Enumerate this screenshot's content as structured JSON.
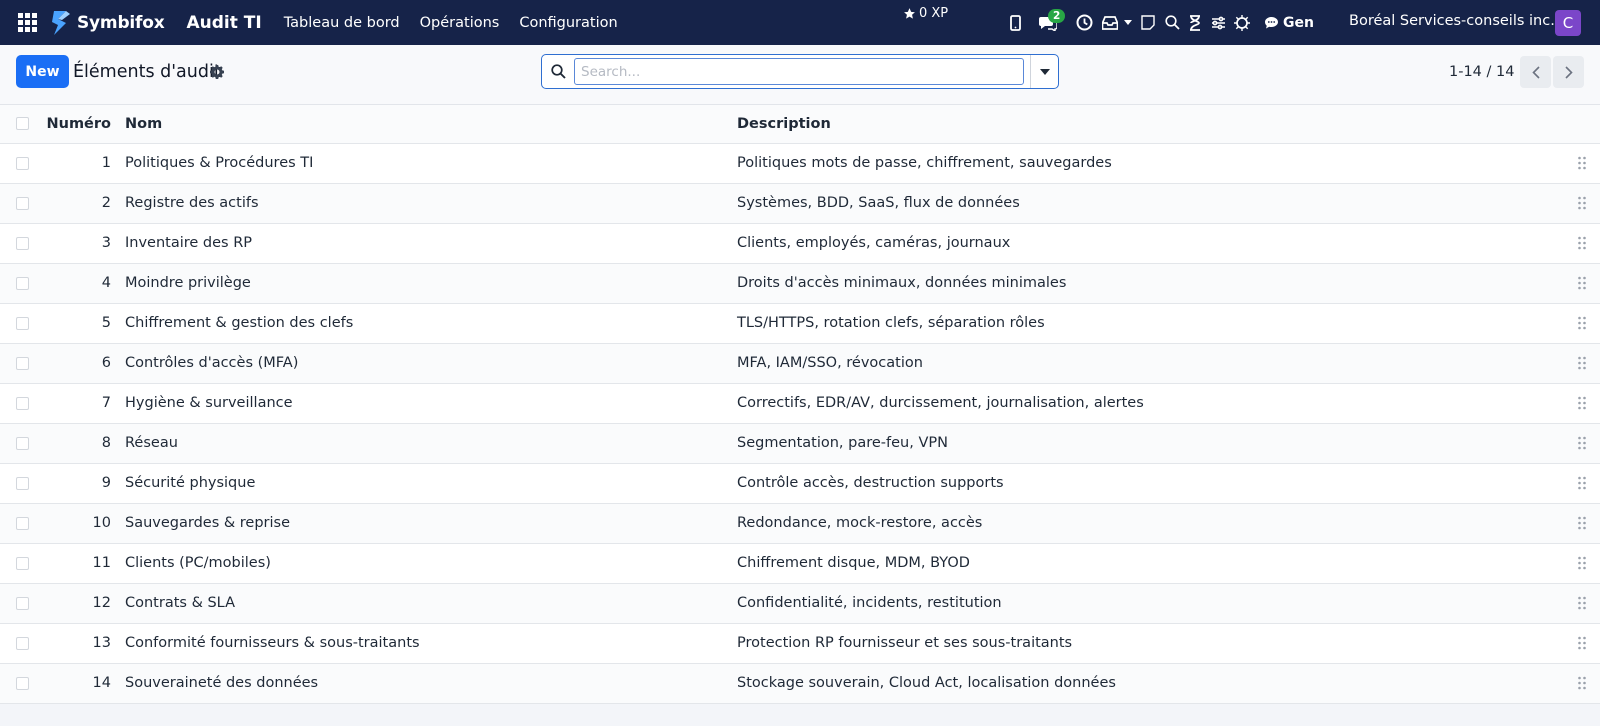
{
  "navbar": {
    "brand": "Symbifox",
    "app_title": "Audit TI",
    "menu": [
      "Tableau de bord",
      "Opérations",
      "Configuration"
    ],
    "xp": "0 XP",
    "messages_count": "2",
    "gen_label": "Gen",
    "company": "Boréal Services-conseils inc.",
    "avatar_letter": "C",
    "colors": {
      "bg": "#162349",
      "badge": "#28a745",
      "avatar": "#7b46c9"
    }
  },
  "control": {
    "new_label": "New",
    "title": "Éléments d'audit",
    "search_placeholder": "Search...",
    "pager": "1-14 / 14",
    "accent": "#1a6ef5"
  },
  "table": {
    "headers": {
      "number": "Numéro",
      "name": "Nom",
      "description": "Description"
    },
    "rows": [
      {
        "number": "1",
        "name": "Politiques & Procédures TI",
        "description": "Politiques mots de passe, chiffrement, sauvegardes"
      },
      {
        "number": "2",
        "name": "Registre des actifs",
        "description": "Systèmes, BDD, SaaS, flux de données"
      },
      {
        "number": "3",
        "name": "Inventaire des RP",
        "description": "Clients, employés, caméras, journaux"
      },
      {
        "number": "4",
        "name": "Moindre privilège",
        "description": "Droits d'accès minimaux, données minimales"
      },
      {
        "number": "5",
        "name": "Chiffrement & gestion des clefs",
        "description": "TLS/HTTPS, rotation clefs, séparation rôles"
      },
      {
        "number": "6",
        "name": "Contrôles d'accès (MFA)",
        "description": "MFA, IAM/SSO, révocation"
      },
      {
        "number": "7",
        "name": "Hygiène & surveillance",
        "description": "Correctifs, EDR/AV, durcissement, journalisation, alertes"
      },
      {
        "number": "8",
        "name": "Réseau",
        "description": "Segmentation, pare-feu, VPN"
      },
      {
        "number": "9",
        "name": "Sécurité physique",
        "description": "Contrôle accès, destruction supports"
      },
      {
        "number": "10",
        "name": "Sauvegardes & reprise",
        "description": "Redondance, mock-restore, accès"
      },
      {
        "number": "11",
        "name": "Clients (PC/mobiles)",
        "description": "Chiffrement disque, MDM, BYOD"
      },
      {
        "number": "12",
        "name": "Contrats & SLA",
        "description": "Confidentialité, incidents, restitution"
      },
      {
        "number": "13",
        "name": "Conformité fournisseurs & sous-traitants",
        "description": "Protection RP fournisseur et ses sous-traitants"
      },
      {
        "number": "14",
        "name": "Souveraineté des données",
        "description": "Stockage souverain, Cloud Act, localisation données"
      }
    ]
  }
}
